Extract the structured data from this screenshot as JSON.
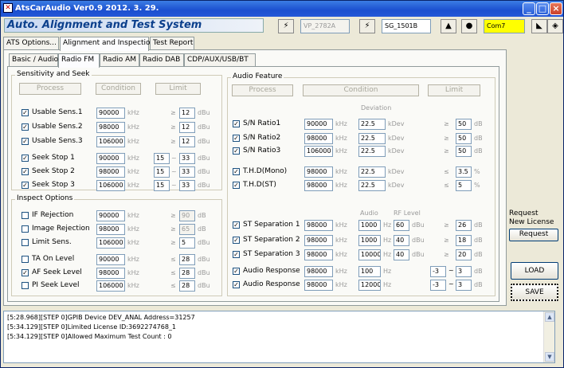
{
  "window": {
    "title": "AtsCarAudio Ver0.9   2012. 3. 29.",
    "icon": "app-icon"
  },
  "banner": "Auto. Alignment and Test System",
  "toolbar": {
    "device1": "VP_2782A",
    "device2": "SG_1501B",
    "port": "Com7"
  },
  "main_tabs": [
    "ATS Options...",
    "Alignment and Inspection",
    "Test Report"
  ],
  "sub_tabs": [
    "Basic / Audio",
    "Radio FM",
    "Radio AM",
    "Radio DAB",
    "CDP/AUX/USB/BT"
  ],
  "sens": {
    "legend": "Sensitivity and Seek",
    "process": "Process",
    "condition": "Condition",
    "limit": "Limit",
    "rows": [
      {
        "label": "Usable Sens.1",
        "checked": true,
        "freq": "90000",
        "unit": "kHz",
        "cmp": "≥",
        "lim": "12",
        "lunit": "dBu"
      },
      {
        "label": "Usable Sens.2",
        "checked": true,
        "freq": "98000",
        "unit": "kHz",
        "cmp": "≥",
        "lim": "12",
        "lunit": "dBu"
      },
      {
        "label": "Usable Sens.3",
        "checked": true,
        "freq": "106000",
        "unit": "kHz",
        "cmp": "≥",
        "lim": "12",
        "lunit": "dBu"
      }
    ],
    "seek": [
      {
        "label": "Seek Stop 1",
        "checked": true,
        "freq": "90000",
        "unit": "kHz",
        "lo": "15",
        "tilde": "~",
        "hi": "33",
        "lunit": "dBu"
      },
      {
        "label": "Seek Stop 2",
        "checked": true,
        "freq": "98000",
        "unit": "kHz",
        "lo": "15",
        "tilde": "~",
        "hi": "33",
        "lunit": "dBu"
      },
      {
        "label": "Seek Stop 3",
        "checked": true,
        "freq": "106000",
        "unit": "kHz",
        "lo": "15",
        "tilde": "~",
        "hi": "33",
        "lunit": "dBu"
      }
    ]
  },
  "inspect": {
    "legend": "Inspect Options",
    "rows": [
      {
        "label": "IF Rejection",
        "checked": false,
        "freq": "90000",
        "unit": "kHz",
        "cmp": "≥",
        "lim": "90",
        "lunit": "dB",
        "dis": true
      },
      {
        "label": "Image Rejection",
        "checked": false,
        "freq": "98000",
        "unit": "kHz",
        "cmp": "≥",
        "lim": "65",
        "lunit": "dB",
        "dis": true
      },
      {
        "label": "Limit Sens.",
        "checked": false,
        "freq": "106000",
        "unit": "kHz",
        "cmp": "≥",
        "lim": "5",
        "lunit": "dBu",
        "dis": false
      },
      {
        "label": "TA On Level",
        "checked": false,
        "freq": "90000",
        "unit": "kHz",
        "cmp": "≤",
        "lim": "28",
        "lunit": "dBu",
        "dis": false
      },
      {
        "label": "AF Seek Level",
        "checked": true,
        "freq": "98000",
        "unit": "kHz",
        "cmp": "≤",
        "lim": "28",
        "lunit": "dBu",
        "dis": false
      },
      {
        "label": "PI Seek Level",
        "checked": false,
        "freq": "106000",
        "unit": "kHz",
        "cmp": "≤",
        "lim": "28",
        "lunit": "dBu",
        "dis": false
      }
    ]
  },
  "audio": {
    "legend": "Audio Feature",
    "process": "Process",
    "condition": "Condition",
    "limit": "Limit",
    "dev_hdr": "Deviation",
    "sn": [
      {
        "label": "S/N Ratio1",
        "checked": true,
        "freq": "90000",
        "unit": "kHz",
        "dev": "22.5",
        "dunit": "kDev",
        "cmp": "≥",
        "lim": "50",
        "lunit": "dB"
      },
      {
        "label": "S/N Ratio2",
        "checked": true,
        "freq": "98000",
        "unit": "kHz",
        "dev": "22.5",
        "dunit": "kDev",
        "cmp": "≥",
        "lim": "50",
        "lunit": "dB"
      },
      {
        "label": "S/N Ratio3",
        "checked": true,
        "freq": "106000",
        "unit": "kHz",
        "dev": "22.5",
        "dunit": "kDev",
        "cmp": "≥",
        "lim": "50",
        "lunit": "dB"
      }
    ],
    "thd": [
      {
        "label": "T.H.D(Mono)",
        "checked": true,
        "freq": "98000",
        "unit": "kHz",
        "dev": "22.5",
        "dunit": "kDev",
        "cmp": "≤",
        "lim": "3.5",
        "lunit": "%"
      },
      {
        "label": "T.H.D(ST)",
        "checked": true,
        "freq": "98000",
        "unit": "kHz",
        "dev": "22.5",
        "dunit": "kDev",
        "cmp": "≤",
        "lim": "5",
        "lunit": "%"
      }
    ],
    "audio_hdr": "Audio",
    "rf_hdr": "RF Level",
    "st": [
      {
        "label": "ST Separation 1",
        "checked": true,
        "freq": "98000",
        "unit": "kHz",
        "aud": "1000",
        "aunit": "Hz",
        "rf": "60",
        "rfunit": "dBu",
        "cmp": "≥",
        "lim": "26",
        "lunit": "dB"
      },
      {
        "label": "ST Separation 2",
        "checked": true,
        "freq": "98000",
        "unit": "kHz",
        "aud": "1000",
        "aunit": "Hz",
        "rf": "40",
        "rfunit": "dBu",
        "cmp": "≥",
        "lim": "18",
        "lunit": "dB"
      },
      {
        "label": "ST Separation 3",
        "checked": true,
        "freq": "98000",
        "unit": "kHz",
        "aud": "10000",
        "aunit": "Hz",
        "rf": "40",
        "rfunit": "dBu",
        "cmp": "≥",
        "lim": "20",
        "lunit": "dB"
      }
    ],
    "resp": [
      {
        "label": "Audio Response",
        "checked": true,
        "freq": "98000",
        "unit": "kHz",
        "aud": "100",
        "aunit": "Hz",
        "lo": "-3",
        "tilde": "~",
        "hi": "3",
        "lunit": "dB"
      },
      {
        "label": "Audio Response",
        "checked": true,
        "freq": "98000",
        "unit": "kHz",
        "aud": "12000",
        "aunit": "Hz",
        "lo": "-3",
        "tilde": "~",
        "hi": "3",
        "lunit": "dB"
      }
    ]
  },
  "right": {
    "request_text1": "Request",
    "request_text2": "New License",
    "request_btn": "Request",
    "load": "LOAD",
    "save": "SAVE"
  },
  "log": [
    "[5:28.968][STEP 0]GPIB Device DEV_ANAL Address=31257",
    "[5:34.129][STEP 0]Limited License ID:3692274768_1",
    "[5:34.129][STEP 0]Allowed Maximum Test Count : 0"
  ]
}
